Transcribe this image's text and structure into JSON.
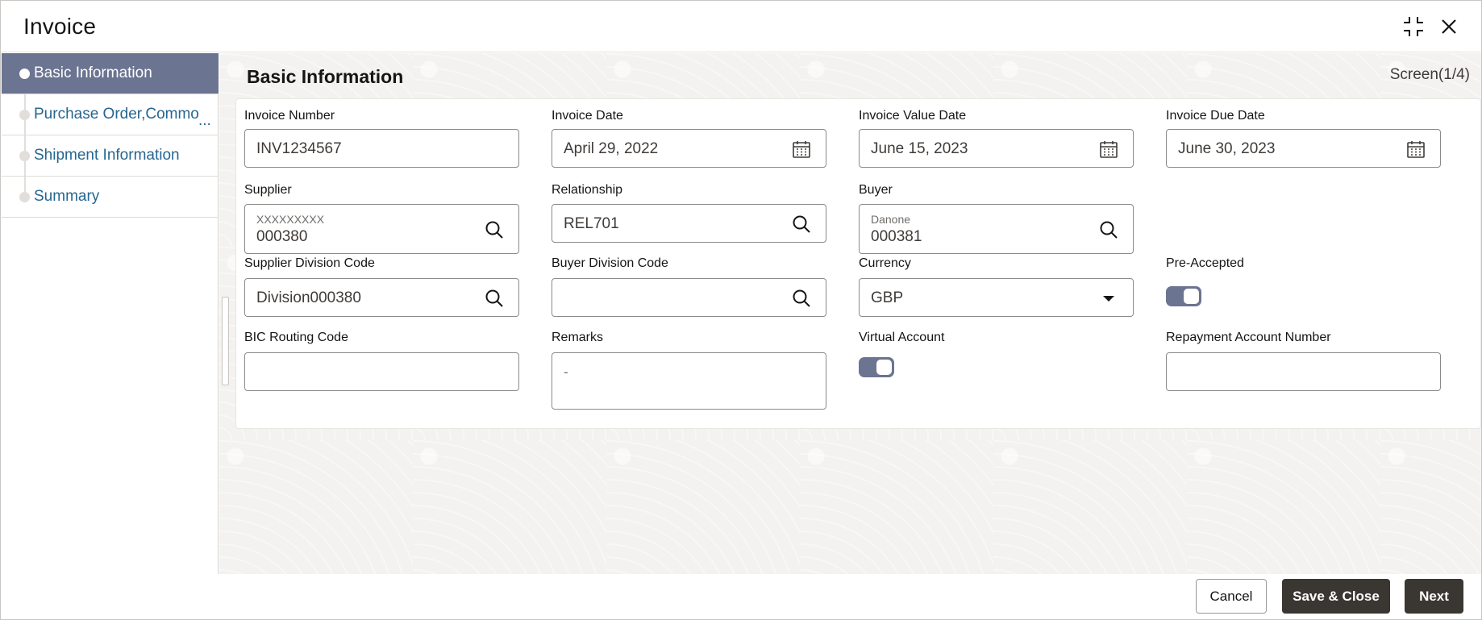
{
  "window": {
    "title": "Invoice"
  },
  "sidebar": {
    "steps": [
      {
        "label": "Basic Information",
        "active": true
      },
      {
        "label": "Purchase Order,Commo",
        "suffix": "...",
        "active": false
      },
      {
        "label": "Shipment Information",
        "active": false
      },
      {
        "label": "Summary",
        "active": false
      }
    ]
  },
  "main": {
    "section_title": "Basic Information",
    "screen_indicator": "Screen(1/4)"
  },
  "form": {
    "invoice_number": {
      "label": "Invoice Number",
      "value": "INV1234567"
    },
    "invoice_date": {
      "label": "Invoice Date",
      "value": "April 29, 2022"
    },
    "invoice_value_date": {
      "label": "Invoice Value Date",
      "value": "June 15, 2023"
    },
    "invoice_due_date": {
      "label": "Invoice Due Date",
      "value": "June 30, 2023"
    },
    "supplier": {
      "label": "Supplier",
      "name": "XXXXXXXXX",
      "value": "000380"
    },
    "relationship": {
      "label": "Relationship",
      "value": "REL701"
    },
    "buyer": {
      "label": "Buyer",
      "name": "Danone",
      "value": "000381"
    },
    "supplier_division_code": {
      "label": "Supplier Division Code",
      "value": "Division000380"
    },
    "buyer_division_code": {
      "label": "Buyer Division Code",
      "value": ""
    },
    "currency": {
      "label": "Currency",
      "value": "GBP"
    },
    "pre_accepted": {
      "label": "Pre-Accepted",
      "on": true
    },
    "bic_routing_code": {
      "label": "BIC Routing Code",
      "value": ""
    },
    "remarks": {
      "label": "Remarks",
      "value": "-"
    },
    "virtual_account": {
      "label": "Virtual Account",
      "on": true
    },
    "repayment_account_number": {
      "label": "Repayment Account Number",
      "value": ""
    }
  },
  "footer": {
    "cancel_label": "Cancel",
    "save_close_label": "Save & Close",
    "next_label": "Next"
  },
  "icons": {
    "minimize": "collapse-arrows-icon",
    "close": "close-icon",
    "calendar": "calendar-icon",
    "search": "search-icon",
    "dropdown": "chevron-down-icon"
  },
  "colors": {
    "active_step": "#6b7491",
    "step_link": "#266690",
    "primary_button": "#3a3632",
    "toggle_on": "#6b7491"
  }
}
